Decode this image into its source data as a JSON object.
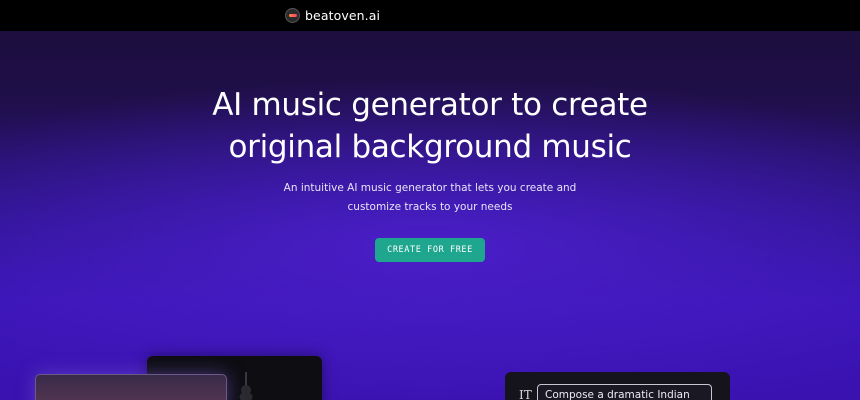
{
  "nav": {
    "brand": "beatoven.ai",
    "logo_icon": "beatoven-logo-icon"
  },
  "hero": {
    "title_line1": "AI music generator to create",
    "title_line2": "original background music",
    "subtitle_line1": "An intuitive AI music generator that lets you create and",
    "subtitle_line2": "customize tracks to your needs",
    "cta_label": "CREATE FOR FREE"
  },
  "prompt_card": {
    "icon": "text-icon",
    "icon_glyph": "IT",
    "input_text": "Compose a dramatic Indian"
  },
  "colors": {
    "accent": "#1fa68e",
    "background_top": "#1b0d38",
    "background_bottom": "#3a14b6",
    "topbar": "#000000"
  }
}
